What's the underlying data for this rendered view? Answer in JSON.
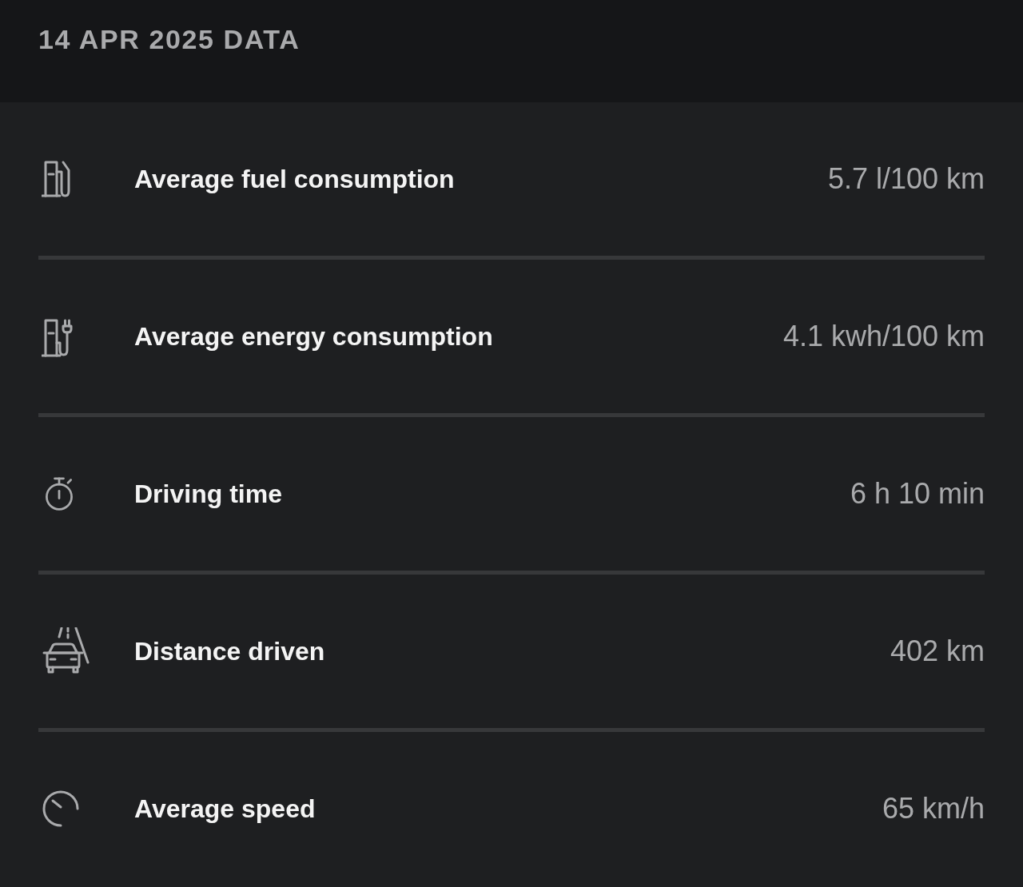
{
  "header": {
    "title": "14 APR 2025 DATA"
  },
  "stats": [
    {
      "kind": "fuel",
      "label": "Average fuel consumption",
      "value": "5.7 l/100 km"
    },
    {
      "kind": "energy",
      "label": "Average energy consumption",
      "value": "4.1 kwh/100 km"
    },
    {
      "kind": "time",
      "label": "Driving time",
      "value": "6 h 10 min"
    },
    {
      "kind": "distance",
      "label": "Distance driven",
      "value": "402 km"
    },
    {
      "kind": "speed",
      "label": "Average speed",
      "value": "65 km/h"
    }
  ]
}
